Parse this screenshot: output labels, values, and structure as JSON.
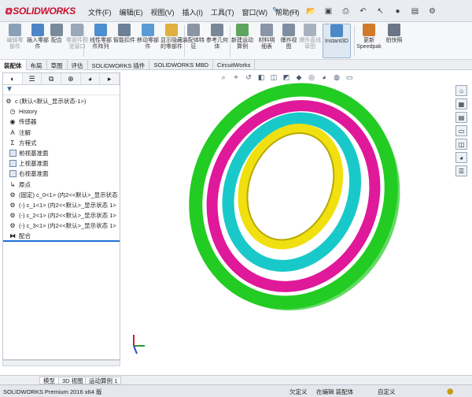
{
  "app": {
    "logo": "SOLIDWORKS",
    "menu": [
      "文件(F)",
      "编辑(E)",
      "视图(V)",
      "插入(I)",
      "工具(T)",
      "窗口(W)",
      "帮助(H)"
    ]
  },
  "commands": [
    {
      "label": "编辑零部件",
      "disabled": true,
      "color": "#8aa0b8"
    },
    {
      "label": "插入零部件",
      "disabled": false,
      "color": "#4d86c6"
    },
    {
      "label": "配合",
      "disabled": false,
      "color": "#7a8a9a"
    },
    {
      "label": "零部件预览窗口",
      "disabled": true,
      "color": "#9aa8b8"
    },
    {
      "label": "线性零部件阵列",
      "disabled": false,
      "color": "#4c8ed0"
    },
    {
      "label": "智能扣件",
      "disabled": false,
      "color": "#6d7f96"
    },
    {
      "label": "移动零部件",
      "disabled": false,
      "color": "#5b9bd5"
    },
    {
      "label": "显示隐藏的零部件",
      "disabled": false,
      "color": "#e0b040"
    },
    {
      "label": "装配体特征",
      "disabled": false,
      "color": "#8b95a3"
    },
    {
      "label": "参考几何体",
      "disabled": false,
      "color": "#7a8796"
    },
    {
      "label": "新建运动算例",
      "disabled": false,
      "color": "#5fa55f"
    },
    {
      "label": "材料明细表",
      "disabled": false,
      "color": "#8a96a6"
    },
    {
      "label": "爆炸视图",
      "disabled": false,
      "color": "#7f8ea0"
    },
    {
      "label": "爆炸直线草图",
      "disabled": true,
      "color": "#a8b2be"
    },
    {
      "label": "Instant3D",
      "disabled": false,
      "color": "#4a88c8",
      "active": true
    },
    {
      "label": "更新Speedpak",
      "disabled": false,
      "color": "#d07a2a"
    },
    {
      "label": "拍快照",
      "disabled": false,
      "color": "#6a7585"
    }
  ],
  "command_tabs": [
    "装配体",
    "布局",
    "草图",
    "评估",
    "SOLIDWORKS 插件",
    "SOLIDWORKS MBD",
    "CircuitWorks"
  ],
  "tree": {
    "root": "c  (默认<默认_显示状态-1>)",
    "items": [
      {
        "label": "History",
        "icon": "history-icon"
      },
      {
        "label": "传感器",
        "icon": "sensor-icon"
      },
      {
        "label": "注解",
        "icon": "annotation-icon"
      },
      {
        "label": "方程式",
        "icon": "equation-icon"
      },
      {
        "label": "前视基准面",
        "icon": "plane-icon"
      },
      {
        "label": "上视基准面",
        "icon": "plane-icon"
      },
      {
        "label": "右视基准面",
        "icon": "plane-icon"
      },
      {
        "label": "原点",
        "icon": "origin-icon"
      },
      {
        "label": "(固定) c_0<1> (内2<<默认>_显示状态",
        "icon": "part-icon"
      },
      {
        "label": "(-) c_1<1> (内2<<默认>_显示状态 1>",
        "icon": "part-icon"
      },
      {
        "label": "(-) c_2<1> (内2<<默认>_显示状态 1>",
        "icon": "part-icon"
      },
      {
        "label": "(-) c_3<1> (内2<<默认>_显示状态 1>",
        "icon": "part-icon"
      },
      {
        "label": "配合",
        "icon": "mates-icon"
      }
    ]
  },
  "bottom_tabs": [
    "模型",
    "3D 视图",
    "运动算例 1"
  ],
  "status": {
    "product": "SOLIDWORKS Premium 2016 x64 版",
    "defined": "欠定义",
    "mode": "在编辑 装配体",
    "custom": "自定义"
  },
  "rings": [
    {
      "name": "outer",
      "color": "#22cc22"
    },
    {
      "name": "second",
      "color": "#e0189a"
    },
    {
      "name": "third",
      "color": "#19c9c9"
    },
    {
      "name": "inner",
      "color": "#f0e010"
    }
  ]
}
